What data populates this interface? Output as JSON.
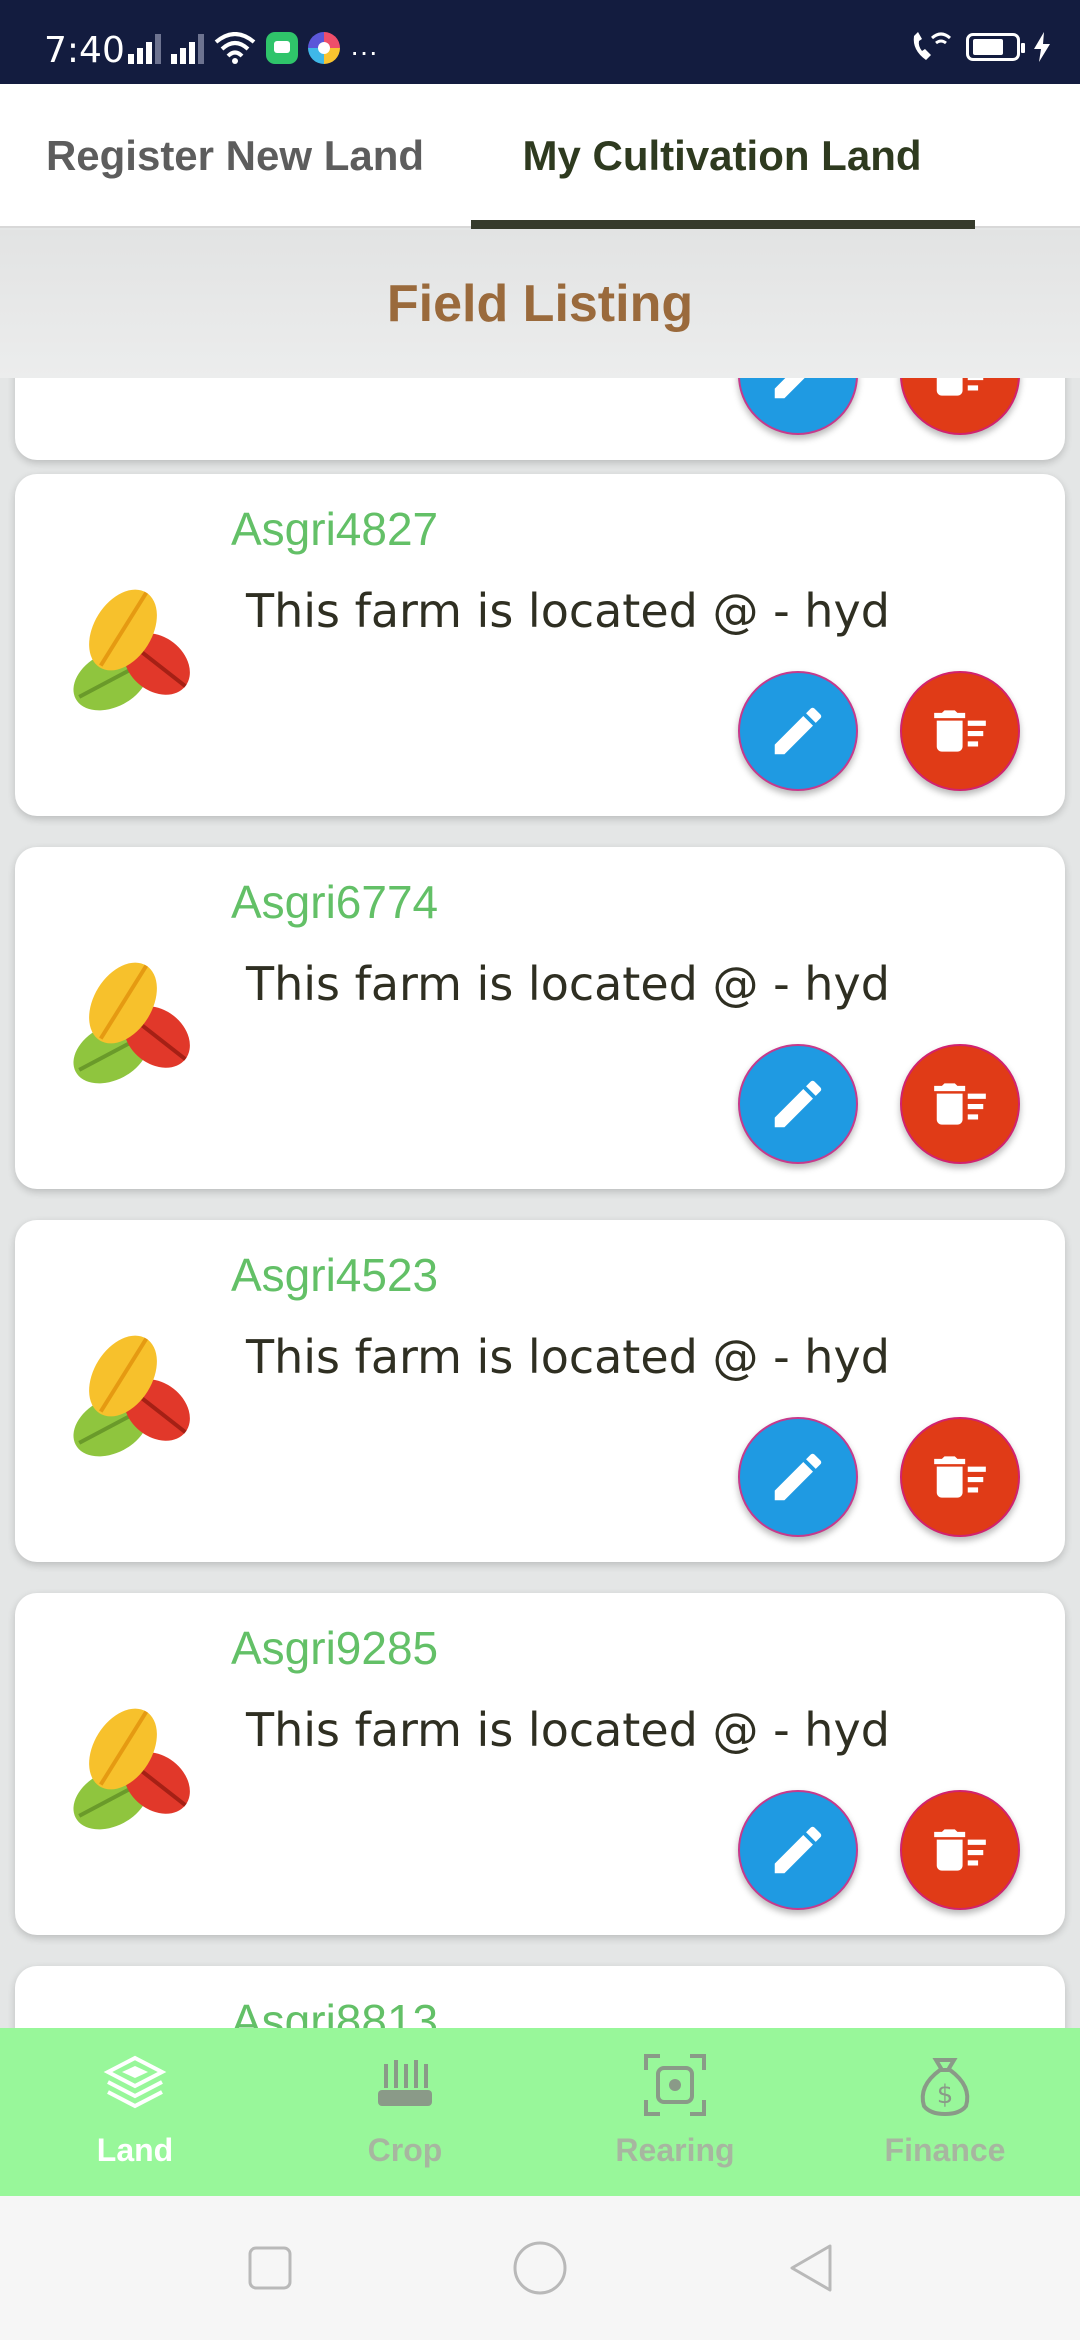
{
  "status_bar": {
    "time": "7:40",
    "more": "···"
  },
  "tabs": [
    {
      "label": "Register New Land",
      "active": false
    },
    {
      "label": "My Cultivation Land",
      "active": true
    }
  ],
  "page": {
    "title": "Field Listing"
  },
  "fields": [
    {
      "name": "",
      "description": ""
    },
    {
      "name": "Asgri4827",
      "description": "This farm is located @ - hyd"
    },
    {
      "name": "Asgri6774",
      "description": "This farm is located @ - hyd"
    },
    {
      "name": "Asgri4523",
      "description": "This farm is located @ - hyd"
    },
    {
      "name": "Asgri9285",
      "description": "This farm is located @ - hyd"
    },
    {
      "name": "Asgri8813",
      "description": ""
    }
  ],
  "card_actions": {
    "edit_icon": "pencil-icon",
    "delete_icon": "delete-list-icon"
  },
  "bottom_nav": [
    {
      "label": "Land",
      "icon": "layers-icon",
      "active": true
    },
    {
      "label": "Crop",
      "icon": "crop-icon",
      "active": false
    },
    {
      "label": "Rearing",
      "icon": "scan-icon",
      "active": false
    },
    {
      "label": "Finance",
      "icon": "money-bag-icon",
      "active": false
    }
  ],
  "colors": {
    "status_bar": "#131c3f",
    "field_name": "#63c067",
    "title": "#9a6a3c",
    "edit_button": "#1f9ae2",
    "delete_button": "#e03b17",
    "bottom_nav": "#98f79a"
  }
}
